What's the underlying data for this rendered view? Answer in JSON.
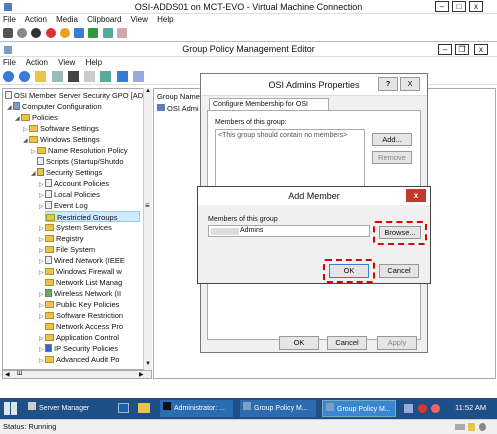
{
  "vm": {
    "title": "OSI-ADDS01 on MCT-EVO - Virtual Machine Connection",
    "menu": [
      "File",
      "Action",
      "Media",
      "Clipboard",
      "View",
      "Help"
    ]
  },
  "gpme": {
    "title": "Group Policy Management Editor",
    "menu": [
      "File",
      "Action",
      "View",
      "Help"
    ],
    "tree": [
      {
        "label": "OSI Member Server Security GPO [ADI",
        "icon": "document-icon"
      },
      {
        "label": "Computer Configuration",
        "icon": "computer-icon"
      },
      {
        "label": "Policies",
        "icon": "folder-icon"
      },
      {
        "label": "Software Settings",
        "icon": "folder-icon"
      },
      {
        "label": "Windows Settings",
        "icon": "folder-icon"
      },
      {
        "label": "Name Resolution Policy",
        "icon": "folder-icon"
      },
      {
        "label": "Scripts (Startup/Shutdo",
        "icon": "document-icon"
      },
      {
        "label": "Security Settings",
        "icon": "shield-icon"
      },
      {
        "label": "Account Policies",
        "icon": "folder-icon"
      },
      {
        "label": "Local Policies",
        "icon": "folder-icon"
      },
      {
        "label": "Event Log",
        "icon": "folder-icon"
      },
      {
        "label": "Restricted Groups",
        "icon": "folder-icon"
      },
      {
        "label": "System Services",
        "icon": "folder-icon"
      },
      {
        "label": "Registry",
        "icon": "folder-icon"
      },
      {
        "label": "File System",
        "icon": "folder-icon"
      },
      {
        "label": "Wired Network (IEEE",
        "icon": "folder-icon"
      },
      {
        "label": "Windows Firewall w",
        "icon": "folder-icon"
      },
      {
        "label": "Network List Manag",
        "icon": "folder-icon"
      },
      {
        "label": "Wireless Network (II",
        "icon": "folder-icon"
      },
      {
        "label": "Public Key Policies",
        "icon": "folder-icon"
      },
      {
        "label": "Software Restriction",
        "icon": "folder-icon"
      },
      {
        "label": "Network Access Pro",
        "icon": "folder-icon"
      },
      {
        "label": "Application Control",
        "icon": "folder-icon"
      },
      {
        "label": "IP Security Policies",
        "icon": "folder-icon"
      },
      {
        "label": "Advanced Audit Po",
        "icon": "folder-icon"
      }
    ],
    "list_header": "Group Name",
    "list_items": [
      "OSI Admi"
    ]
  },
  "properties": {
    "title": "OSI Admins Properties",
    "help_btn": "?",
    "close_btn": "X",
    "tab": "Configure Membership for OSI Admins",
    "members_label": "Members of this group:",
    "empty_text": "<This group should contain no members>",
    "add_btn": "Add...",
    "remove_btn": "Remove",
    "ok_btn": "OK",
    "cancel_btn": "Cancel",
    "apply_btn": "Apply"
  },
  "add_member": {
    "title": "Add Member",
    "label": "Members of this group",
    "value": "Admins",
    "browse_btn": "Browse...",
    "ok_btn": "OK",
    "cancel_btn": "Cancel"
  },
  "taskbar": {
    "items": [
      "Server Manager",
      "Administrator: ...",
      "Group Policy M...",
      "Group Policy M..."
    ],
    "time": "11:52 AM"
  },
  "status": {
    "text": "Status: Running"
  },
  "colors": {
    "taskbar": "#1e4f86",
    "highlight": "#d00000",
    "selection": "#cde8ff",
    "add_member_close": "#c0392b"
  }
}
